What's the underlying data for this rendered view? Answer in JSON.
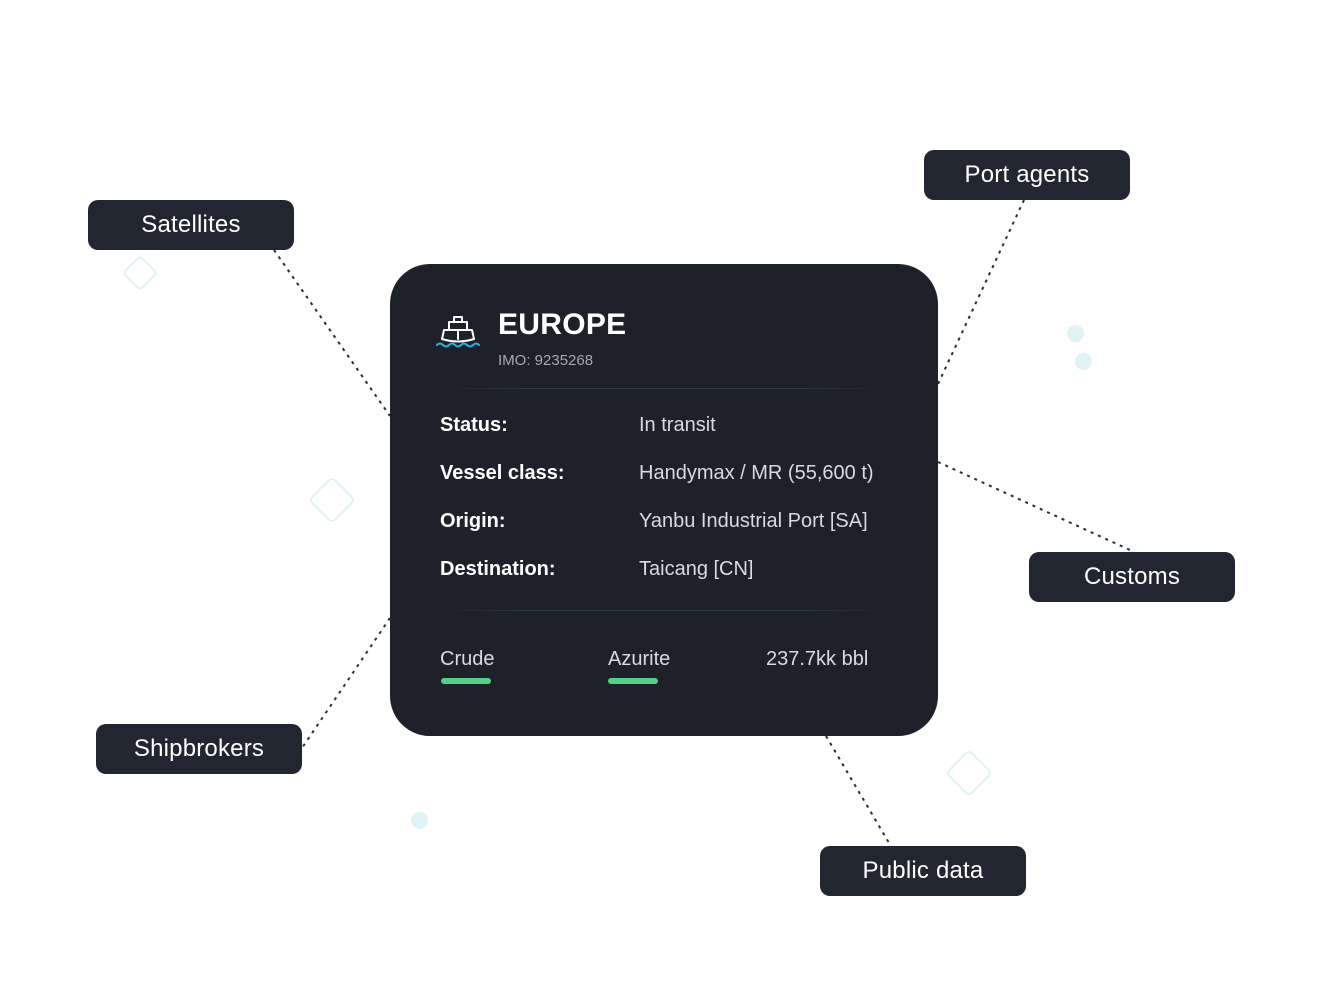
{
  "sources": {
    "satellites": "Satellites",
    "port_agents": "Port agents",
    "customs": "Customs",
    "shipbrokers": "Shipbrokers",
    "public_data": "Public data"
  },
  "vessel": {
    "icon": "ship-icon",
    "name": "EUROPE",
    "imo": "IMO: 9235268",
    "details": [
      {
        "label": "Status:",
        "value": "In transit"
      },
      {
        "label": "Vessel class:",
        "value": "Handymax / MR (55,600 t)"
      },
      {
        "label": "Origin:",
        "value": "Yanbu Industrial Port [SA]"
      },
      {
        "label": "Destination:",
        "value": "Taicang [CN]"
      }
    ],
    "cargo": {
      "type": "Crude",
      "grade": "Azurite",
      "volume": "237.7kk bbl"
    }
  },
  "colors": {
    "card_bg": "#1e2129",
    "pill_bg": "#222630",
    "accent_green": "#4fd18a",
    "icon_blue": "#27b4e0",
    "decoration": "#dff3f7"
  }
}
